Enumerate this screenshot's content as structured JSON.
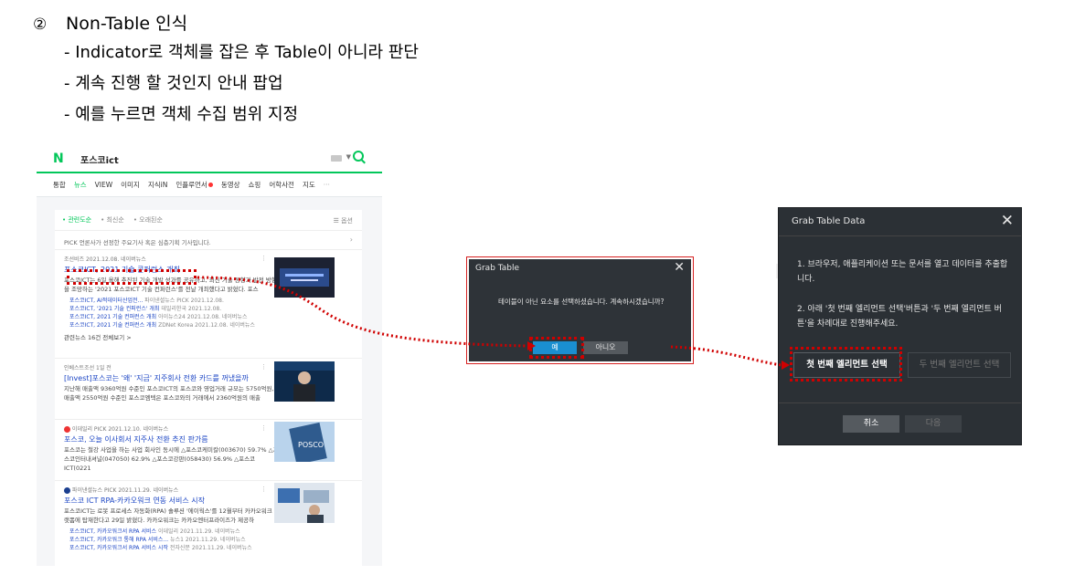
{
  "heading": {
    "number": "②",
    "title": "Non-Table 인식",
    "bullets": [
      "- Indicator로 객체를 잡은 후 Table이 아니라 판단",
      "- 계속 진행 할 것인지 안내 팝업",
      "- 예를 누르면 객체 수집 범위 지정"
    ]
  },
  "naver": {
    "logo": "N",
    "query": "포스코ict",
    "tabs": [
      "통합",
      "뉴스",
      "VIEW",
      "이미지",
      "지식iN",
      "인플루언서",
      "동영상",
      "쇼핑",
      "어학사전",
      "지도",
      "···"
    ],
    "filters": [
      "관련도순",
      "최신순",
      "오래된순"
    ],
    "option": "옵션",
    "pick_notice": "PICK 언론사가 선정한 주요기사 혹은 심층기획 기사입니다.",
    "articles": [
      {
        "source": "조선비즈   2021.12.08.   네이버뉴스",
        "title": "포스코ICT, 2021 기술 콘퍼런스 개최",
        "desc": "포스코ICT는 6일 올해 추진된 기술 개발 성과를 공유하고, 최신 기술 동향과 발전 방향을 조망하는 '2021 포스코ICT 기술 컨퍼런스'를 전날 개최했다고 밝혔다. 포스",
        "subs": [
          {
            "title": "포스코ICT, AI적데이터산업전...",
            "meta": "파이낸셜뉴스 PICK   2021.12.08."
          },
          {
            "title": "포스코ICT, '2021 기술 컨퍼런스' 개최",
            "meta": "데일리한국   2021.12.08."
          },
          {
            "title": "포스코ICT, 2021 기술 컨퍼런스 개최",
            "meta": "아이뉴스24   2021.12.08.   네이버뉴스"
          },
          {
            "title": "포스코ICT, 2021 기술 컨퍼런스 개최",
            "meta": "ZDNet Korea   2021.12.08.   네이버뉴스"
          }
        ],
        "more": "관련뉴스 16건 전체보기 >"
      },
      {
        "source": "인베스트조선   1일 전",
        "title": "[Invest]포스코는 '왜' '지금' 지주회사 전환 카드를 꺼냈을까",
        "desc": "지난해 매출액 9360억원 수준인 포스코ICT의 포스코와 영업거래 규모는 5750억원, 매출액 2550억원 수준인 포스코엠텍은 포스코와의 거래에서 2360억원의 매출"
      },
      {
        "source": "이데일리 PICK   2021.12.10.   네이버뉴스",
        "title": "포스코, 오늘 이사회서 지주사 전환 추진 판가름",
        "desc": "포스코는 철강 사업을 하는 사업 회사인 동시에 △포스코케미칼(003670) 59.7% △포스코인터내셔널(047050) 62.9% △포스코강판(058430) 56.9% △포스코ICT(0221"
      },
      {
        "source": "파이낸셜뉴스 PICK   2021.11.29.   네이버뉴스",
        "title": "포스코 ICT RPA-카카오워크 연동 서비스 시작",
        "desc": "포스코ICT는 로봇 프로세스 자동화(RPA) 솔루션 '에이웍스'를 12월부터 카카오워크 플랫폼에 탑재한다고 29일 밝혔다. 카카오워크는 카카오엔터프라이즈가 제공하",
        "subs": [
          {
            "title": "포스코ICT, 카카오워크서 RPA 서비스",
            "meta": "이데일리   2021.11.29.   네이버뉴스"
          },
          {
            "title": "포스코ICT, 카카오워크 통해 RPA 서비스...",
            "meta": "뉴스1   2021.11.29.   네이버뉴스"
          },
          {
            "title": "포스코ICT, 카카오워크서 RPA 서비스 시작",
            "meta": "전자신문   2021.11.29.   네이버뉴스"
          }
        ]
      }
    ]
  },
  "grab_table": {
    "title": "Grab Table",
    "close": "✕",
    "message": "테이블이 아닌 요소를 선택하셨습니다. 계속하시겠습니까?",
    "yes_label": "예",
    "no_label": "아니오"
  },
  "grab_table_data": {
    "title": "Grab Table Data",
    "close": "✕",
    "step1": "1. 브라우저, 애플리케이션 또는 문서를 열고 데이터를 추출합니다.",
    "step2": "2. 아래 '첫 번째 엘리먼트 선택'버튼과 '두 번째 엘리먼트 버튼'을 차례대로 진행해주세요.",
    "first_button": "첫 번째 엘리먼트 선택",
    "second_button": "두 번째 엘리먼트 선택",
    "cancel_label": "취소",
    "next_label": "다음"
  },
  "colors": {
    "highlight": "#d00000",
    "naver_green": "#03c75a",
    "link_blue": "#1b45c4",
    "dialog_bg": "#2e3338",
    "yes_blue": "#1a8fd0"
  }
}
